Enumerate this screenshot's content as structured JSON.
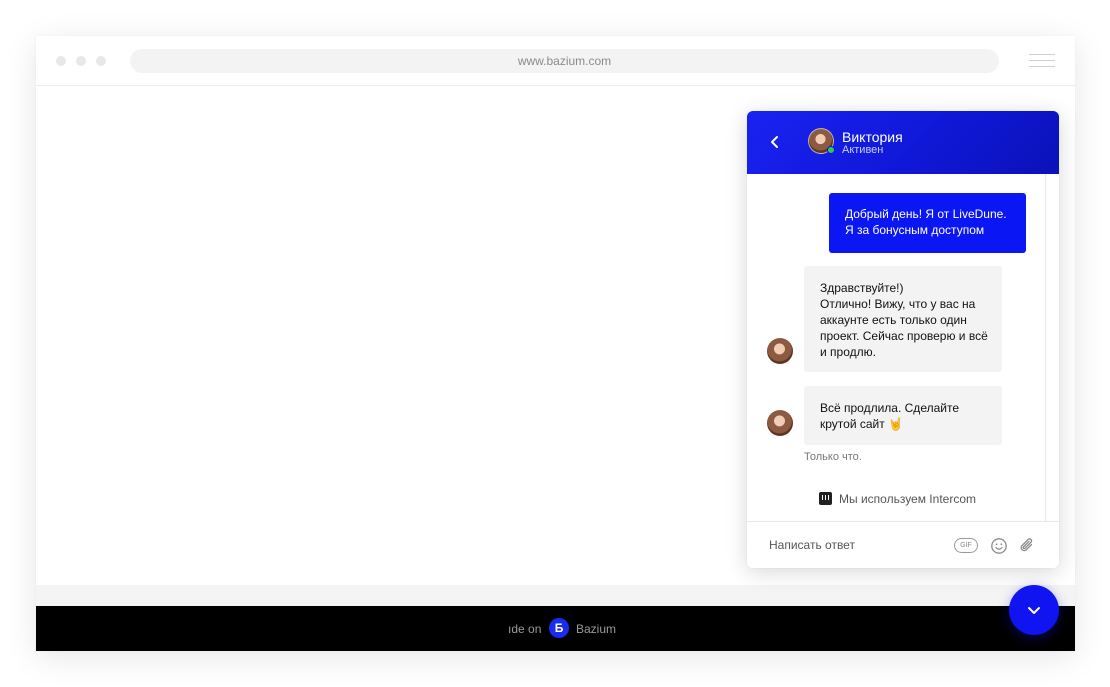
{
  "browser": {
    "url": "www.bazium.com"
  },
  "footer": {
    "made_on_text": "ıde on",
    "logo_letter": "Б",
    "brand": "Bazium"
  },
  "chat": {
    "agent_name": "Виктория",
    "agent_status": "Активен",
    "messages": [
      {
        "from": "user",
        "text": "Добрый день! Я от LiveDune. Я за бонусным доступом"
      },
      {
        "from": "agent",
        "text": "Здравствуйте!)\nОтлично! Вижу, что у вас на аккаунте есть только один проект. Сейчас проверю и всё и продлю."
      },
      {
        "from": "agent",
        "text": "Всё продлила. Сделайте крутой сайт 🤘"
      }
    ],
    "timestamp": "Только что.",
    "powered_by": "Мы используем Intercom",
    "composer_placeholder": "Написать ответ",
    "gif_label": "GIF"
  },
  "icons": {
    "back": "chevron-left-icon",
    "emoji": "smiley-icon",
    "attach": "paperclip-icon",
    "launcher": "chevron-down-icon",
    "intercom": "intercom-logo-icon"
  },
  "colors": {
    "accent_blue": "#0b16f5",
    "header_gradient_start": "#1a22f2",
    "header_gradient_end": "#0a12b8",
    "online": "#32c853",
    "footer_bg": "#000000"
  }
}
